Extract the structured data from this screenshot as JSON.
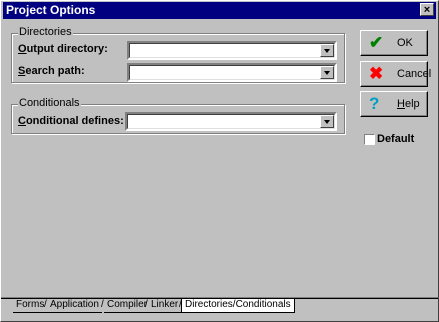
{
  "window": {
    "title": "Project Options",
    "close_glyph": "×"
  },
  "directories": {
    "group_label": "Directories",
    "output_directory": {
      "label_hotkey": "O",
      "label_rest": "utput directory:",
      "value": ""
    },
    "search_path": {
      "label_hotkey": "S",
      "label_rest": "earch path:",
      "value": ""
    }
  },
  "conditionals": {
    "group_label": "Conditionals",
    "conditional_defines": {
      "label_hotkey": "C",
      "label_rest": "onditional defines:",
      "value": ""
    }
  },
  "buttons": {
    "ok": {
      "label": "OK",
      "icon": "checkmark-icon",
      "color": "#008000"
    },
    "cancel": {
      "label": "Cancel",
      "icon": "x-icon",
      "color": "#ff0000"
    },
    "help": {
      "label_hotkey": "H",
      "label_rest": "elp",
      "icon": "question-icon",
      "color": "#00a0c0"
    }
  },
  "default_checkbox": {
    "label": "Default",
    "checked": false
  },
  "tabs": [
    {
      "label": "Forms",
      "active": false
    },
    {
      "label": "Application",
      "active": false
    },
    {
      "label": "Compiler",
      "active": false
    },
    {
      "label": "Linker",
      "active": false
    },
    {
      "label": "Directories/Conditionals",
      "active": true
    }
  ]
}
